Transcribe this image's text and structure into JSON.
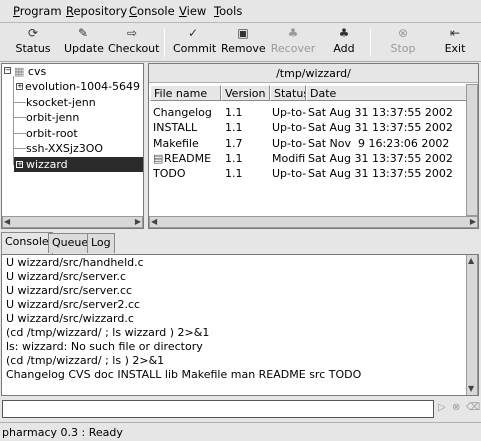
{
  "menu": [
    {
      "label": "Program",
      "ul": "P",
      "rest": "rogram"
    },
    {
      "label": "Repository",
      "ul": "R",
      "rest": "epository"
    },
    {
      "label": "Console",
      "ul": "C",
      "rest": "onsole"
    },
    {
      "label": "View",
      "ul": "V",
      "rest": "iew"
    },
    {
      "label": "Tools",
      "ul": "T",
      "rest": "ools"
    }
  ],
  "toolbar": {
    "status": "Status",
    "update": "Update",
    "checkout": "Checkout",
    "commit": "Commit",
    "remove": "Remove",
    "recover": "Recover",
    "add": "Add",
    "stop": "Stop",
    "exit": "Exit"
  },
  "tree": {
    "root": "cvs",
    "items": [
      "evolution-1004-5649",
      "ksocket-jenn",
      "orbit-jenn",
      "orbit-root",
      "ssh-XXSjz3OO",
      "wizzard"
    ],
    "selected": "wizzard"
  },
  "files": {
    "path": "/tmp/wizzard/",
    "columns": [
      "File name",
      "Version",
      "Status",
      "Date"
    ],
    "rows": [
      {
        "name": "Changelog",
        "version": "1.1",
        "status": "Up-to-",
        "date": "Sat Aug 31 13:37:55 2002"
      },
      {
        "name": "INSTALL",
        "version": "1.1",
        "status": "Up-to-",
        "date": "Sat Aug 31 13:37:55 2002"
      },
      {
        "name": "Makefile",
        "version": "1.7",
        "status": "Up-to-",
        "date": "Sat Nov  9 16:23:06 2002"
      },
      {
        "name": "README",
        "version": "1.1",
        "status": "Modifi",
        "date": "Sat Aug 31 13:37:55 2002"
      },
      {
        "name": "TODO",
        "version": "1.1",
        "status": "Up-to-",
        "date": "Sat Aug 31 13:37:55 2002"
      }
    ]
  },
  "tabs": [
    "Console",
    "Queue",
    "Log"
  ],
  "console": {
    "lines": [
      "U wizzard/src/handheld.c",
      "U wizzard/src/server.c",
      "U wizzard/src/server.cc",
      "U wizzard/src/server2.cc",
      "U wizzard/src/wizzard.c",
      "(cd /tmp/wizzard/ ; ls wizzard ) 2>&1",
      "ls: wizzard: No such file or directory",
      "(cd /tmp/wizzard/ ; ls ) 2>&1",
      "Changelog CVS doc INSTALL lib Makefile man README src TODO"
    ]
  },
  "command_input": {
    "value": ""
  },
  "status": "pharmacy 0.3 : Ready"
}
